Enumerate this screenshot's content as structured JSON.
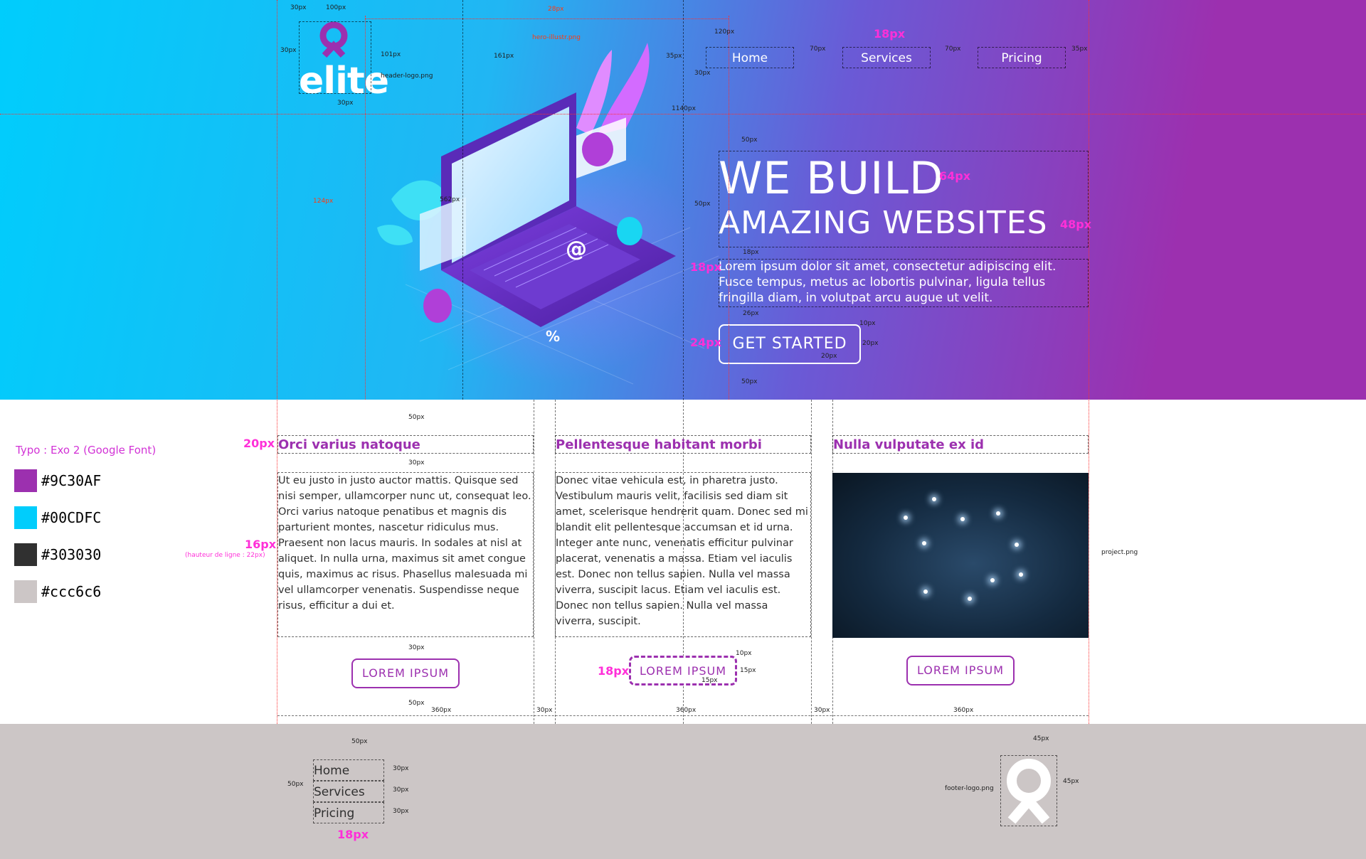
{
  "header": {
    "logo_text": "elite",
    "logo_file": "header-logo.png",
    "hero_file": "hero-illustr.png",
    "nav": [
      {
        "label": "Home"
      },
      {
        "label": "Services"
      },
      {
        "label": "Pricing"
      }
    ],
    "nav_font_spec": "18px"
  },
  "hero": {
    "title_line1": "WE BUILD",
    "title_line2": "AMAZING WEBSITES",
    "title1_spec": "64px",
    "title2_spec": "48px",
    "paragraph": "Lorem ipsum dolor sit amet, consectetur adipiscing elit. Fusce tempus, metus ac lobortis pulvinar, ligula tellus fringilla diam, in volutpat arcu augue ut velit.",
    "paragraph_spec": "18px",
    "cta_label": "GET STARTED",
    "cta_spec": "24px"
  },
  "specs": {
    "s30a": "30px",
    "s100": "100px",
    "s28": "28px",
    "s30b": "30px",
    "s101": "101px",
    "s30c": "30px",
    "s161": "161px",
    "s120": "120px",
    "s35a": "35px",
    "s70a": "70px",
    "s70b": "70px",
    "s35b": "35px",
    "s30d": "30px",
    "s1140": "1140px",
    "s50a": "50px",
    "s124": "124px",
    "s562": "562px",
    "s50b": "50px",
    "s18": "18px",
    "s26": "26px",
    "s10a": "10px",
    "s20a": "20px",
    "s20b": "20px",
    "s50c": "50px",
    "s50d": "50px",
    "s30e": "30px",
    "s30f": "30px",
    "s50e": "50px",
    "s360a": "360px",
    "s30g": "30px",
    "s360b": "360px",
    "s30h": "30px",
    "s360c": "360px",
    "s10b": "10px",
    "s15a": "15px",
    "s15b": "15px",
    "s50f": "50px",
    "s30i": "30px",
    "s30j": "30px",
    "s30k": "30px",
    "s50g": "50px",
    "s45a": "45px",
    "s45b": "45px"
  },
  "styleguide": {
    "typo": "Typo : Exo 2 (Google Font)",
    "colors": [
      {
        "hex": "#9C30AF",
        "label": "#9C30AF"
      },
      {
        "hex": "#00CDFC",
        "label": "#00CDFC"
      },
      {
        "hex": "#303030",
        "label": "#303030"
      },
      {
        "hex": "#ccc6c6",
        "label": "#ccc6c6"
      }
    ],
    "title_spec": "20px",
    "body_spec": "16px",
    "body_line_spec": "(hauteur de ligne : 22px)",
    "button_spec": "18px"
  },
  "columns": [
    {
      "title": "Orci varius natoque",
      "text": "Ut eu justo in justo auctor mattis. Quisque sed nisi semper, ullamcorper nunc ut, consequat leo. Orci varius natoque penatibus et magnis dis parturient montes, nascetur ridiculus mus. Praesent non lacus mauris. In sodales at nisl at aliquet. In nulla urna, maximus sit amet congue quis, maximus ac risus. Phasellus malesuada mi vel ullamcorper venenatis. Suspendisse neque risus, efficitur a dui et.",
      "button": "LOREM IPSUM"
    },
    {
      "title": "Pellentesque habitant morbi",
      "text": "Donec vitae vehicula est, in pharetra justo. Vestibulum mauris velit, facilisis sed diam sit amet, scelerisque hendrerit quam. Donec sed mi blandit elit pellentesque accumsan et id urna. Integer ante nunc, venenatis efficitur pulvinar placerat, venenatis a massa. Etiam vel iaculis est. Donec non tellus sapien. Nulla vel massa viverra, suscipit lacus. Etiam vel iaculis est. Donec non tellus sapien. Nulla vel massa viverra, suscipit.",
      "button": "LOREM IPSUM"
    },
    {
      "title": "Nulla vulputate ex id",
      "image_file": "project.png",
      "button": "LOREM IPSUM"
    }
  ],
  "footer": {
    "nav": [
      {
        "label": "Home"
      },
      {
        "label": "Services"
      },
      {
        "label": "Pricing"
      }
    ],
    "nav_spec": "18px",
    "logo_file": "footer-logo.png"
  }
}
